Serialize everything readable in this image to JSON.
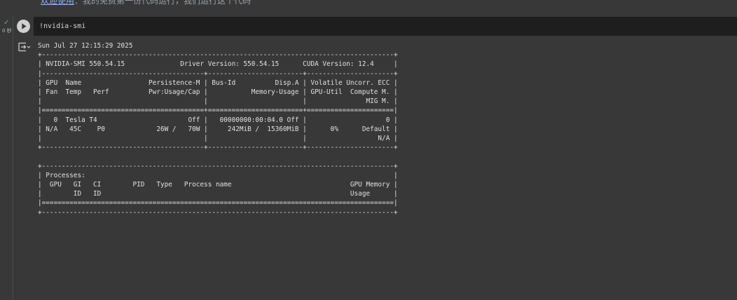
{
  "top_snippet": {
    "link_text": "欢迎使用",
    "rest_text": "：我的免费第一份代码运行，我们运行这个代码"
  },
  "cell": {
    "status_check": "✓",
    "status_time": "0 秒",
    "run_icon": "play-icon",
    "code": "!nvidia-smi",
    "output_toggle_icon": "output-collapse-icon",
    "output": {
      "date_line": "Sun Jul 27 12:15:29 2025",
      "table_lines": [
        "+-----------------------------------------------------------------------------------------+",
        "| NVIDIA-SMI 550.54.15              Driver Version: 550.54.15      CUDA Version: 12.4     |",
        "|-----------------------------------------+------------------------+----------------------+",
        "| GPU  Name                 Persistence-M | Bus-Id          Disp.A | Volatile Uncorr. ECC |",
        "| Fan  Temp   Perf          Pwr:Usage/Cap |           Memory-Usage | GPU-Util  Compute M. |",
        "|                                         |                        |               MIG M. |",
        "|=========================================+========================+======================|",
        "|   0  Tesla T4                       Off |   00000000:00:04.0 Off |                    0 |",
        "| N/A   45C    P0             26W /   70W |     242MiB /  15360MiB |      0%      Default |",
        "|                                         |                        |                  N/A |",
        "+-----------------------------------------+------------------------+----------------------+",
        "",
        "+-----------------------------------------------------------------------------------------+",
        "| Processes:                                                                              |",
        "|  GPU   GI   CI        PID   Type   Process name                              GPU Memory |",
        "|        ID   ID                                                               Usage      |",
        "|=========================================================================================|",
        "+-----------------------------------------------------------------------------------------+"
      ]
    }
  },
  "colors": {
    "page_bg": "#383838",
    "editor_bg": "#1e1e1e",
    "text": "#e0e0e0",
    "success": "#5bb974",
    "link": "#8ab4f8"
  }
}
